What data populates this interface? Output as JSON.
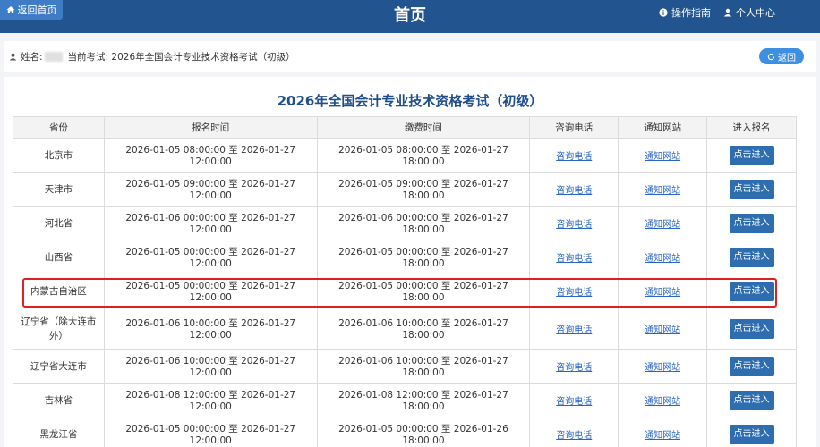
{
  "header": {
    "home_label": "返回首页",
    "title": "首页",
    "guide_label": "操作指南",
    "profile_label": "个人中心"
  },
  "infobar": {
    "name_label": "姓名:",
    "exam_label": "当前考试: 2026年全国会计专业技术资格考试（初级）",
    "back_label": "返回"
  },
  "main": {
    "exam_title": "2026年全国会计专业技术资格考试（初级）",
    "columns": [
      "省份",
      "报名时间",
      "缴费时间",
      "咨询电话",
      "通知网站",
      "进入报名"
    ],
    "rows": [
      {
        "province": "北京市",
        "reg": "2026-01-05 08:00:00 至 2026-01-27 12:00:00",
        "pay": "2026-01-05 08:00:00 至 2026-01-27 18:00:00",
        "phone": "咨询电话",
        "site": "通知网站",
        "enter": "点击进入"
      },
      {
        "province": "天津市",
        "reg": "2026-01-05 09:00:00 至 2026-01-27 12:00:00",
        "pay": "2026-01-05 09:00:00 至 2026-01-27 18:00:00",
        "phone": "咨询电话",
        "site": "通知网站",
        "enter": "点击进入"
      },
      {
        "province": "河北省",
        "reg": "2026-01-06 00:00:00 至 2026-01-27 12:00:00",
        "pay": "2026-01-06 00:00:00 至 2026-01-27 18:00:00",
        "phone": "咨询电话",
        "site": "通知网站",
        "enter": "点击进入"
      },
      {
        "province": "山西省",
        "reg": "2026-01-05 00:00:00 至 2026-01-27 12:00:00",
        "pay": "2026-01-05 00:00:00 至 2026-01-27 18:00:00",
        "phone": "咨询电话",
        "site": "通知网站",
        "enter": "点击进入"
      },
      {
        "province": "内蒙古自治区",
        "reg": "2026-01-05 00:00:00 至 2026-01-27 12:00:00",
        "pay": "2026-01-05 00:00:00 至 2026-01-27 18:00:00",
        "phone": "咨询电话",
        "site": "通知网站",
        "enter": "点击进入"
      },
      {
        "province": "辽宁省（除大连市外）",
        "reg": "2026-01-06 10:00:00 至 2026-01-27 12:00:00",
        "pay": "2026-01-06 10:00:00 至 2026-01-27 18:00:00",
        "phone": "咨询电话",
        "site": "通知网站",
        "enter": "点击进入"
      },
      {
        "province": "辽宁省大连市",
        "reg": "2026-01-06 10:00:00 至 2026-01-27 12:00:00",
        "pay": "2026-01-06 10:00:00 至 2026-01-27 18:00:00",
        "phone": "咨询电话",
        "site": "通知网站",
        "enter": "点击进入"
      },
      {
        "province": "吉林省",
        "reg": "2026-01-08 12:00:00 至 2026-01-27 12:00:00",
        "pay": "2026-01-08 12:00:00 至 2026-01-27 18:00:00",
        "phone": "咨询电话",
        "site": "通知网站",
        "enter": "点击进入"
      },
      {
        "province": "黑龙江省",
        "reg": "2026-01-05 00:00:00 至 2026-01-27 12:00:00",
        "pay": "2026-01-05 00:00:00 至 2026-01-26 18:00:00",
        "phone": "咨询电话",
        "site": "通知网站",
        "enter": "点击进入"
      }
    ]
  }
}
